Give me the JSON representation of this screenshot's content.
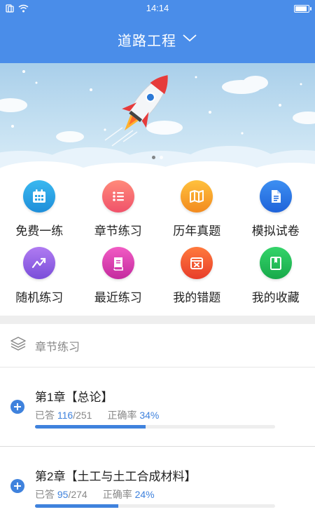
{
  "status": {
    "time": "14:14",
    "icons": [
      "sim-icon",
      "wifi-icon",
      "battery-icon"
    ]
  },
  "header": {
    "title": "道路工程",
    "dropdown_icon": "chevron-down-icon",
    "background": "#4a8de9"
  },
  "banner": {
    "illustration": "rocket-launch",
    "slides": 2,
    "active_slide": 1
  },
  "menu": [
    {
      "label": "免费一练",
      "icon": "calendar-icon",
      "color_from": "#3ab8f0",
      "color_to": "#1e8ed9"
    },
    {
      "label": "章节练习",
      "icon": "list-icon",
      "color_from": "#ff8a7a",
      "color_to": "#f0526a"
    },
    {
      "label": "历年真题",
      "icon": "map-icon",
      "color_from": "#ffc13d",
      "color_to": "#f28a1f"
    },
    {
      "label": "模拟试卷",
      "icon": "document-icon",
      "color_from": "#3d8ff2",
      "color_to": "#1f63d9"
    },
    {
      "label": "随机练习",
      "icon": "trend-icon",
      "color_from": "#b07bf2",
      "color_to": "#7a4ed9"
    },
    {
      "label": "最近练习",
      "icon": "book-icon",
      "color_from": "#f25cc4",
      "color_to": "#c42a9e"
    },
    {
      "label": "我的错题",
      "icon": "error-calendar-icon",
      "color_from": "#ff7a3d",
      "color_to": "#e83d2a"
    },
    {
      "label": "我的收藏",
      "icon": "bookmark-icon",
      "color_from": "#35d46a",
      "color_to": "#17a94a"
    }
  ],
  "section": {
    "title": "章节练习",
    "icon": "layers-icon"
  },
  "chapters": [
    {
      "title": "第1章【总论】",
      "answered_label": "已答",
      "answered": "116",
      "total": "251",
      "accuracy_label": "正确率",
      "accuracy": "34%",
      "progress": 0.462
    },
    {
      "title": "第2章【土工与土工合成材料】",
      "answered_label": "已答",
      "answered": "95",
      "total": "274",
      "accuracy_label": "正确率",
      "accuracy": "24%",
      "progress": 0.347
    }
  ]
}
